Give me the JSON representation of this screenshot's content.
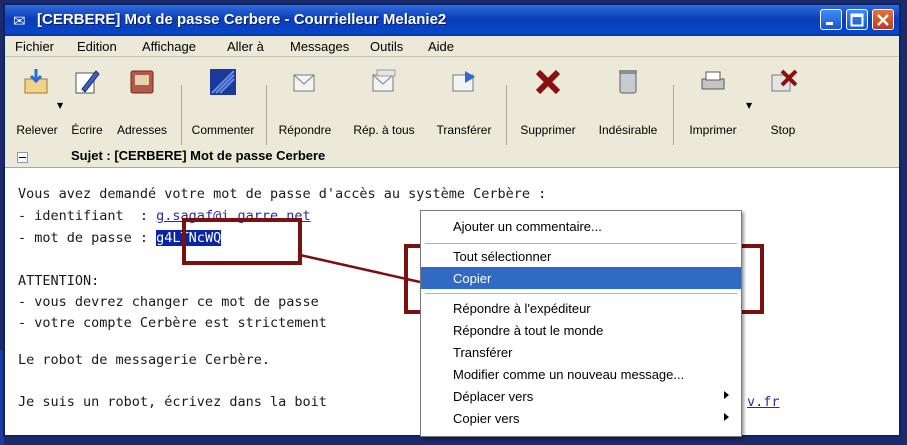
{
  "window": {
    "title": "[CERBERE] Mot de passe Cerbere - Courrielleur Melanie2",
    "controls": {
      "minimize": "minimize",
      "maximize": "maximize",
      "close": "close"
    }
  },
  "menubar": [
    "Fichier",
    "Edition",
    "Affichage",
    "Aller à",
    "Messages",
    "Outils",
    "Aide"
  ],
  "toolbar": [
    {
      "label": "Relever",
      "icon": "get-mail-icon"
    },
    {
      "label": "Écrire",
      "icon": "write-icon"
    },
    {
      "label": "Adresses",
      "icon": "address-book-icon"
    },
    {
      "label": "Commenter",
      "icon": "comment-icon"
    },
    {
      "label": "Répondre",
      "icon": "reply-icon"
    },
    {
      "label": "Rép. à tous",
      "icon": "reply-all-icon"
    },
    {
      "label": "Transférer",
      "icon": "forward-icon"
    },
    {
      "label": "Supprimer",
      "icon": "delete-icon"
    },
    {
      "label": "Indésirable",
      "icon": "junk-icon"
    },
    {
      "label": "Imprimer",
      "icon": "print-icon"
    },
    {
      "label": "Stop",
      "icon": "stop-icon"
    }
  ],
  "subject": {
    "label": "Sujet : [CERBERE] Mot de passe Cerbere"
  },
  "message": {
    "line1": "Vous avez demandé votre mot de passe d'accès au système Cerbère :",
    "id_prefix": "- identifiant  : ",
    "id_value": "g.sagaf@i.garre.net",
    "pw_prefix": "- mot de passe : ",
    "pw_value": "g4LTNcWQ",
    "attention": "ATTENTION:",
    "warn1": "- vous devrez changer ce mot de passe",
    "warn2": "- votre compte Cerbère est strictement",
    "robot": "Le robot de messagerie Cerbère.",
    "robot2": "Je suis un robot, écrivez dans la boit",
    "robot2_link": "v.fr"
  },
  "context_menu": {
    "items": [
      {
        "label": "Ajouter un commentaire..."
      },
      {
        "label": "Tout sélectionner"
      },
      {
        "label": "Copier",
        "highlighted": true
      },
      {
        "label": "Répondre à l'expéditeur"
      },
      {
        "label": "Répondre à tout le monde"
      },
      {
        "label": "Transférer"
      },
      {
        "label": "Modifier comme un nouveau message..."
      },
      {
        "label": "Déplacer vers",
        "submenu": true
      },
      {
        "label": "Copier vers",
        "submenu": true
      }
    ]
  },
  "colors": {
    "titlebar": "#0a3db8",
    "selection": "#0a24a6",
    "menu_highlight": "#316ac5",
    "annotation": "#7a1010"
  }
}
